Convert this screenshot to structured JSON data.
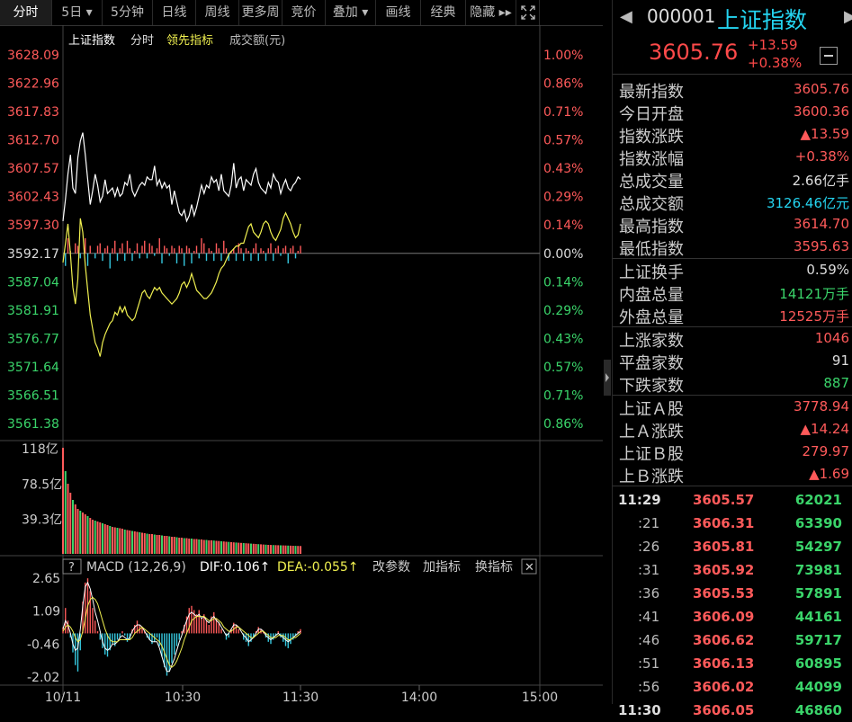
{
  "toolbar": {
    "items": [
      "分时",
      "5日 ▾",
      "5分钟",
      "日线",
      "周线",
      "更多周",
      "竞价",
      "叠加 ▾",
      "画线",
      "经典",
      "隐藏 ▸▸"
    ]
  },
  "legend": {
    "symbol": "上证指数",
    "mode": "分时",
    "indicator": "领先指标",
    "volume": "成交额(元)"
  },
  "chart_data": [
    {
      "type": "line",
      "title": "",
      "x_start": "10/11",
      "x_ticks": [
        "10/11",
        "10:30",
        "11:30",
        "14:00",
        "15:00"
      ],
      "prev_close": 3592.17,
      "ylim": [
        3561.38,
        3628.09
      ],
      "y_ticks_left": [
        "3628.09",
        "3622.96",
        "3617.83",
        "3612.70",
        "3607.57",
        "3602.43",
        "3597.30",
        "3592.17",
        "3587.04",
        "3581.91",
        "3576.77",
        "3571.64",
        "3566.51",
        "3561.38"
      ],
      "y_ticks_right": [
        "1.00%",
        "0.86%",
        "0.71%",
        "0.57%",
        "0.43%",
        "0.29%",
        "0.14%",
        "0.00%",
        "0.14%",
        "0.29%",
        "0.43%",
        "0.57%",
        "0.71%",
        "0.86%"
      ],
      "series": [
        {
          "name": "上证指数",
          "values": [
            3598.0,
            3602.0,
            3606.5,
            3610.0,
            3604.0,
            3603.0,
            3609.5,
            3612.5,
            3614.0,
            3610.0,
            3605.5,
            3601.0,
            3603.5,
            3606.5,
            3604.5,
            3601.5,
            3602.5,
            3605.5,
            3603.0,
            3603.5,
            3604.0,
            3602.5,
            3604.0,
            3602.5,
            3603.0,
            3605.0,
            3604.5,
            3606.5,
            3603.5,
            3602.5,
            3603.5,
            3604.5,
            3605.0,
            3604.5,
            3606.0,
            3605.5,
            3605.5,
            3608.0,
            3604.5,
            3605.5,
            3604.0,
            3605.0,
            3604.0,
            3604.5,
            3601.0,
            3603.5,
            3601.5,
            3599.5,
            3599.0,
            3600.0,
            3598.0,
            3599.0,
            3601.0,
            3599.0,
            3600.5,
            3602.5,
            3604.5,
            3603.0,
            3604.5,
            3604.0,
            3606.0,
            3605.0,
            3605.5,
            3603.5,
            3606.5,
            3603.5,
            3603.0,
            3602.5,
            3604.5,
            3608.5,
            3604.0,
            3605.5,
            3606.0,
            3603.5,
            3605.5,
            3605.0,
            3604.5,
            3606.5,
            3607.5,
            3605.0,
            3604.0,
            3603.5,
            3603.0,
            3605.0,
            3604.0,
            3606.5,
            3605.5,
            3605.0,
            3603.0,
            3604.5,
            3605.5,
            3604.0,
            3603.5,
            3604.5,
            3605.0,
            3606.0,
            3605.57
          ]
        },
        {
          "name": "领先指标",
          "values": [
            3590.5,
            3594.0,
            3597.5,
            3592.0,
            3586.0,
            3583.0,
            3587.5,
            3598.5,
            3596.0,
            3590.0,
            3585.5,
            3581.0,
            3578.5,
            3576.0,
            3575.0,
            3573.5,
            3576.0,
            3577.5,
            3578.5,
            3579.5,
            3580.0,
            3581.5,
            3581.0,
            3582.5,
            3581.5,
            3582.5,
            3581.0,
            3580.5,
            3580.0,
            3580.5,
            3582.0,
            3583.5,
            3585.0,
            3585.5,
            3584.5,
            3584.0,
            3585.0,
            3586.0,
            3585.5,
            3586.0,
            3585.0,
            3584.5,
            3584.0,
            3583.5,
            3583.0,
            3583.5,
            3584.0,
            3585.0,
            3586.5,
            3587.0,
            3586.0,
            3587.0,
            3588.5,
            3587.0,
            3585.5,
            3585.0,
            3584.5,
            3584.0,
            3584.0,
            3584.5,
            3585.0,
            3586.0,
            3587.0,
            3588.5,
            3589.5,
            3590.0,
            3591.0,
            3592.0,
            3592.5,
            3593.0,
            3593.5,
            3593.5,
            3594.0,
            3594.0,
            3595.5,
            3597.0,
            3597.5,
            3596.0,
            3595.5,
            3595.0,
            3596.0,
            3597.5,
            3598.0,
            3597.5,
            3596.0,
            3595.0,
            3594.5,
            3595.5,
            3596.5,
            3598.5,
            3599.5,
            3598.5,
            3597.5,
            3596.0,
            3595.0,
            3595.5,
            3597.5
          ]
        }
      ],
      "bars_up": [
        0.0,
        0.5,
        0.6,
        0.1,
        0.0,
        0.4,
        0.3,
        0.2,
        0.0,
        0.6,
        0.5,
        0.3,
        0.0,
        0.2,
        0.3,
        0.4,
        0.3,
        0.2,
        0.3,
        0.6,
        0.2,
        0.5,
        0.3,
        0.2,
        0.4,
        0.3,
        0.5,
        0.2,
        0.3,
        0.1,
        0.4,
        0.2,
        0.3,
        0.5,
        0.2,
        0.4,
        0.3,
        0.1,
        0.2,
        0.6,
        0.4,
        0.3,
        0.2,
        0.1,
        0.3,
        0.2,
        0.4,
        0.3,
        0.2,
        0.5,
        0.3,
        0.2,
        0.4,
        0.1,
        0.3,
        0.2,
        0.6,
        0.4,
        0.3,
        0.2,
        0.1,
        0.3,
        0.4,
        0.2,
        0.3,
        0.5,
        0.2,
        0.3,
        0.1,
        0.2,
        0.3,
        0.4,
        0.2,
        0.3,
        0.2,
        0.1,
        0.3,
        0.2,
        0.4,
        0.3,
        0.2,
        0.1,
        0.3,
        0.2,
        0.4,
        0.3,
        0.2,
        0.3,
        0.1,
        0.2,
        0.3,
        0.4,
        0.2,
        0.3,
        0.2,
        0.1,
        0.3
      ]
    },
    {
      "type": "bar",
      "title": "",
      "y_ticks": [
        "118亿",
        "78.5亿",
        "39.3亿"
      ],
      "ylim": [
        0,
        118
      ],
      "values": [
        118,
        92,
        78,
        68,
        60,
        55,
        50,
        48,
        46,
        44,
        42,
        40,
        38,
        37,
        36,
        35,
        34,
        33,
        32,
        31,
        30,
        29.5,
        29,
        28.5,
        28,
        27,
        26.5,
        26,
        25.5,
        25,
        24.5,
        24,
        23.5,
        23,
        22.5,
        22,
        22,
        21.5,
        21,
        21,
        20.5,
        20,
        20,
        19.5,
        19,
        19,
        18.5,
        18,
        18,
        17.5,
        17.5,
        17,
        17,
        16.5,
        16.5,
        16,
        16,
        15.5,
        15.5,
        15,
        15,
        14.8,
        14.5,
        14.3,
        14,
        13.8,
        13.5,
        13.3,
        13,
        12.8,
        12.6,
        12.4,
        12.2,
        12,
        11.8,
        11.6,
        11.4,
        11.2,
        11,
        10.8,
        10.6,
        10.4,
        10.2,
        10,
        9.9,
        9.8,
        9.7,
        9.6,
        9.5,
        9.4,
        9.3,
        9.2,
        9.1,
        9,
        8.9,
        8.8,
        8.7
      ]
    },
    {
      "type": "bar",
      "title": "",
      "indicator": "MACD (12,26,9)",
      "dif": "DIF:0.106↑",
      "dea": "DEA:-0.055↑",
      "y_ticks": [
        "2.65",
        "1.09",
        "-0.46",
        "-2.02"
      ],
      "ylim": [
        -2.02,
        2.65
      ],
      "values": [
        0.3,
        1.2,
        0.6,
        -0.2,
        -0.9,
        -1.5,
        -1.8,
        -0.8,
        1.5,
        2.4,
        2.6,
        2.0,
        1.2,
        0.6,
        0.1,
        -0.3,
        -0.7,
        -1.0,
        -1.1,
        -0.8,
        -0.5,
        -0.6,
        -0.3,
        -0.2,
        0.1,
        -0.1,
        -0.4,
        -0.3,
        0.2,
        0.4,
        0.6,
        0.4,
        0.3,
        0.1,
        -0.2,
        -0.3,
        -0.5,
        -0.4,
        -0.2,
        -0.6,
        -1.1,
        -1.6,
        -2.0,
        -1.8,
        -1.4,
        -1.0,
        -0.6,
        -0.3,
        0.1,
        0.4,
        0.8,
        1.2,
        1.3,
        1.1,
        0.9,
        1.1,
        0.7,
        0.9,
        0.6,
        0.4,
        0.8,
        1.0,
        0.7,
        0.5,
        0.2,
        0.0,
        -0.3,
        -0.2,
        0.2,
        0.5,
        0.4,
        0.2,
        0.0,
        -0.3,
        -0.4,
        -0.6,
        -0.4,
        -0.2,
        0.1,
        0.3,
        0.2,
        0.1,
        -0.2,
        -0.4,
        -0.5,
        -0.3,
        -0.1,
        0.1,
        -0.2,
        -0.4,
        -0.6,
        -0.7,
        -0.5,
        -0.3,
        -0.1,
        0.1,
        0.2
      ],
      "dif_values": [
        0.2,
        0.6,
        0.4,
        0.0,
        -0.5,
        -0.8,
        -0.7,
        0.2,
        1.3,
        2.2,
        2.4,
        2.1,
        1.6,
        1.0,
        0.6,
        0.1,
        -0.4,
        -0.7,
        -0.8,
        -0.7,
        -0.5,
        -0.5,
        -0.4,
        -0.2,
        -0.1,
        -0.2,
        -0.3,
        -0.2,
        0.1,
        0.3,
        0.4,
        0.4,
        0.3,
        0.1,
        -0.1,
        -0.3,
        -0.4,
        -0.4,
        -0.4,
        -0.7,
        -1.1,
        -1.5,
        -1.8,
        -1.8,
        -1.5,
        -1.2,
        -0.8,
        -0.4,
        -0.1,
        0.3,
        0.6,
        0.9,
        1.0,
        0.9,
        0.8,
        0.9,
        0.7,
        0.8,
        0.6,
        0.5,
        0.7,
        0.8,
        0.6,
        0.5,
        0.3,
        0.1,
        -0.1,
        0.0,
        0.2,
        0.4,
        0.4,
        0.3,
        0.1,
        -0.1,
        -0.2,
        -0.4,
        -0.3,
        -0.2,
        0.0,
        0.2,
        0.2,
        0.1,
        -0.1,
        -0.2,
        -0.3,
        -0.2,
        -0.1,
        0.0,
        -0.1,
        -0.2,
        -0.3,
        -0.4,
        -0.3,
        -0.2,
        -0.1,
        0.0,
        0.1
      ],
      "dea_values": [
        0.1,
        0.3,
        0.4,
        0.3,
        0.1,
        -0.2,
        -0.4,
        -0.3,
        0.1,
        0.7,
        1.3,
        1.6,
        1.7,
        1.6,
        1.4,
        1.0,
        0.6,
        0.2,
        -0.1,
        -0.3,
        -0.4,
        -0.4,
        -0.4,
        -0.3,
        -0.3,
        -0.3,
        -0.3,
        -0.3,
        -0.2,
        0.0,
        0.1,
        0.2,
        0.3,
        0.2,
        0.1,
        0.0,
        -0.1,
        -0.2,
        -0.3,
        -0.4,
        -0.6,
        -0.9,
        -1.2,
        -1.5,
        -1.6,
        -1.5,
        -1.3,
        -1.0,
        -0.7,
        -0.3,
        0.0,
        0.3,
        0.6,
        0.7,
        0.8,
        0.8,
        0.8,
        0.8,
        0.7,
        0.6,
        0.6,
        0.7,
        0.7,
        0.6,
        0.5,
        0.3,
        0.2,
        0.1,
        0.1,
        0.2,
        0.3,
        0.3,
        0.2,
        0.1,
        0.0,
        -0.1,
        -0.2,
        -0.2,
        -0.1,
        0.0,
        0.1,
        0.1,
        0.0,
        -0.1,
        -0.2,
        -0.2,
        -0.2,
        -0.1,
        -0.1,
        -0.1,
        -0.2,
        -0.3,
        -0.3,
        -0.2,
        -0.2,
        -0.1,
        0.0
      ]
    }
  ],
  "macd_menu": {
    "help": "?",
    "params": "改参数",
    "add": "加指标",
    "switch": "换指标",
    "close": "✕"
  },
  "right": {
    "code": "000001",
    "name": "上证指数",
    "price": "3605.76",
    "change": "+13.59",
    "change_pct": "+0.38%",
    "stats": [
      {
        "label": "最新指数",
        "value": "3605.76",
        "color": "red"
      },
      {
        "label": "今日开盘",
        "value": "3600.36",
        "color": "red"
      },
      {
        "label": "指数涨跌",
        "value": "▲13.59",
        "color": "red"
      },
      {
        "label": "指数涨幅",
        "value": "+0.38%",
        "color": "red"
      },
      {
        "label": "总成交量",
        "value": "2.66亿手",
        "color": "white"
      },
      {
        "label": "总成交额",
        "value": "3126.46亿元",
        "color": "cyan"
      },
      {
        "label": "最高指数",
        "value": "3614.70",
        "color": "red"
      },
      {
        "label": "最低指数",
        "value": "3595.63",
        "color": "red"
      }
    ],
    "stats2": [
      {
        "label": "上证换手",
        "value": "0.59%",
        "color": "white"
      },
      {
        "label": "内盘总量",
        "value": "14121万手",
        "color": "green"
      },
      {
        "label": "外盘总量",
        "value": "12525万手",
        "color": "red"
      }
    ],
    "stats3": [
      {
        "label": "上涨家数",
        "value": "1046",
        "color": "red"
      },
      {
        "label": "平盘家数",
        "value": "91",
        "color": "white"
      },
      {
        "label": "下跌家数",
        "value": "887",
        "color": "green"
      }
    ],
    "stats4": [
      {
        "label": "上证Ａ股",
        "value": "3778.94",
        "color": "red"
      },
      {
        "label": "上Ａ涨跌",
        "value": "▲14.24",
        "color": "red"
      },
      {
        "label": "上证Ｂ股",
        "value": "279.97",
        "color": "red"
      },
      {
        "label": "上Ｂ涨跌",
        "value": "▲1.69",
        "color": "red"
      }
    ],
    "ticks": [
      {
        "time": "11:29",
        "price": "3605.57",
        "vol": "62021",
        "main": true
      },
      {
        "time": ":21",
        "price": "3606.31",
        "vol": "63390",
        "main": false
      },
      {
        "time": ":26",
        "price": "3605.81",
        "vol": "54297",
        "main": false
      },
      {
        "time": ":31",
        "price": "3605.92",
        "vol": "73981",
        "main": false
      },
      {
        "time": ":36",
        "price": "3605.53",
        "vol": "57891",
        "main": false
      },
      {
        "time": ":41",
        "price": "3606.09",
        "vol": "44161",
        "main": false
      },
      {
        "time": ":46",
        "price": "3606.62",
        "vol": "59717",
        "main": false
      },
      {
        "time": ":51",
        "price": "3606.13",
        "vol": "60895",
        "main": false
      },
      {
        "time": ":56",
        "price": "3606.02",
        "vol": "44099",
        "main": false
      },
      {
        "time": "11:30",
        "price": "3606.05",
        "vol": "46860",
        "main": true
      }
    ]
  },
  "colors": {
    "red": "#ff5a5a",
    "green": "#3ad46a",
    "white": "#dddddd",
    "cyan": "#24d4f0",
    "yellow": "#f0f050",
    "line": "#ffffff"
  }
}
